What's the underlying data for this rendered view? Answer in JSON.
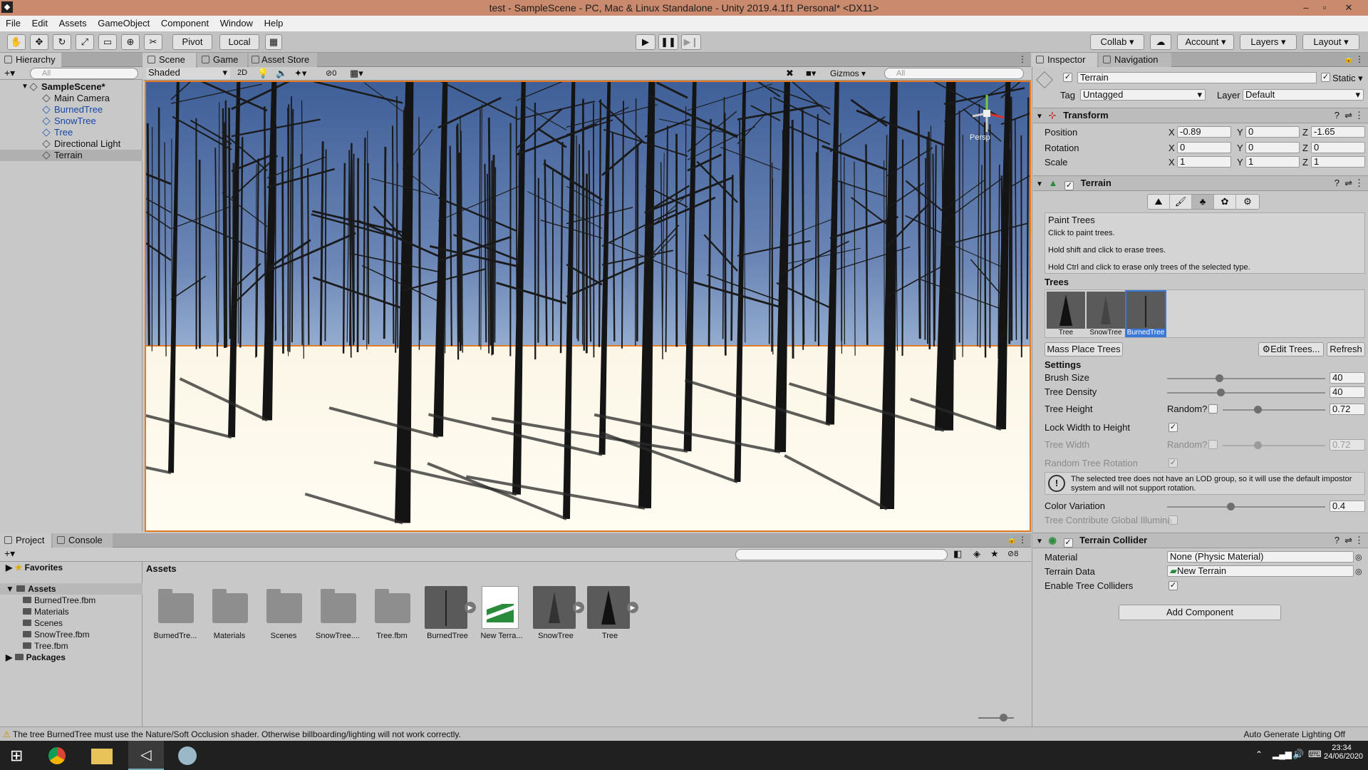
{
  "window": {
    "title": "test - SampleScene - PC, Mac & Linux Standalone - Unity 2019.4.1f1 Personal* <DX11>"
  },
  "menu": [
    "File",
    "Edit",
    "Assets",
    "GameObject",
    "Component",
    "Window",
    "Help"
  ],
  "toolbar": {
    "pivot": "Pivot",
    "local": "Local",
    "collab": "Collab",
    "account": "Account",
    "layers": "Layers",
    "layout": "Layout"
  },
  "hierarchy": {
    "tab": "Hierarchy",
    "search_placeholder": "All",
    "scene": "SampleScene*",
    "items": [
      {
        "label": "Main Camera",
        "prefab": false
      },
      {
        "label": "BurnedTree",
        "prefab": true
      },
      {
        "label": "SnowTree",
        "prefab": true
      },
      {
        "label": "Tree",
        "prefab": true
      },
      {
        "label": "Directional Light",
        "prefab": false
      },
      {
        "label": "Terrain",
        "prefab": false,
        "selected": true
      }
    ]
  },
  "scene_view": {
    "tabs": [
      "Scene",
      "Game",
      "Asset Store"
    ],
    "shading": "Shaded",
    "mode2d": "2D",
    "hidden_count": "0",
    "gizmos": "Gizmos",
    "search_placeholder": "All",
    "persp": "Persp"
  },
  "inspector": {
    "tabs": [
      "Inspector",
      "Navigation"
    ],
    "object_name": "Terrain",
    "static": "Static",
    "tag_label": "Tag",
    "tag": "Untagged",
    "layer_label": "Layer",
    "layer": "Default",
    "transform": {
      "title": "Transform",
      "position": {
        "label": "Position",
        "x": "-0.89",
        "y": "0",
        "z": "-1.65"
      },
      "rotation": {
        "label": "Rotation",
        "x": "0",
        "y": "0",
        "z": "0"
      },
      "scale": {
        "label": "Scale",
        "x": "1",
        "y": "1",
        "z": "1"
      }
    },
    "terrain": {
      "title": "Terrain",
      "help_title": "Paint Trees",
      "help_lines": [
        "Click to paint trees.",
        "Hold shift and click to erase trees.",
        "Hold Ctrl and click to erase only trees of the selected type."
      ],
      "trees_label": "Trees",
      "trees": [
        {
          "label": "Tree"
        },
        {
          "label": "SnowTree"
        },
        {
          "label": "BurnedTree",
          "selected": true
        }
      ],
      "mass_place": "Mass Place Trees",
      "edit_trees": "Edit Trees...",
      "refresh": "Refresh",
      "settings_label": "Settings",
      "brush_size": {
        "label": "Brush Size",
        "value": "40",
        "fraction": 0.33
      },
      "tree_density": {
        "label": "Tree Density",
        "value": "40",
        "fraction": 0.34
      },
      "tree_height": {
        "label": "Tree Height",
        "random": "Random?",
        "value": "0.72",
        "fraction": 0.34
      },
      "lock_width": {
        "label": "Lock Width to Height",
        "checked": true
      },
      "tree_width": {
        "label": "Tree Width",
        "random": "Random?",
        "value": "0.72",
        "fraction": 0.34
      },
      "random_rotation": {
        "label": "Random Tree Rotation"
      },
      "lod_warning": "The selected tree does not have an LOD group, so it will use the default impostor system and will not support rotation.",
      "color_variation": {
        "label": "Color Variation",
        "value": "0.4",
        "fraction": 0.4
      },
      "global_illum": "Tree Contribute Global Illumina"
    },
    "collider": {
      "title": "Terrain Collider",
      "material_label": "Material",
      "material": "None (Physic Material)",
      "data_label": "Terrain Data",
      "data": "New Terrain",
      "enable_label": "Enable Tree Colliders"
    },
    "add_component": "Add Component"
  },
  "project": {
    "tabs": [
      "Project",
      "Console"
    ],
    "tree": {
      "favorites": "Favorites",
      "assets": "Assets",
      "children": [
        "BurnedTree.fbm",
        "Materials",
        "Scenes",
        "SnowTree.fbm",
        "Tree.fbm"
      ],
      "packages": "Packages"
    },
    "breadcrumb": "Assets",
    "hidden_count": "8",
    "assets": [
      {
        "label": "BurnedTre...",
        "kind": "folder"
      },
      {
        "label": "Materials",
        "kind": "folder"
      },
      {
        "label": "Scenes",
        "kind": "folder"
      },
      {
        "label": "SnowTree....",
        "kind": "folder"
      },
      {
        "label": "Tree.fbm",
        "kind": "folder"
      },
      {
        "label": "BurnedTree",
        "kind": "model"
      },
      {
        "label": "New Terra...",
        "kind": "terrain"
      },
      {
        "label": "SnowTree",
        "kind": "model"
      },
      {
        "label": "Tree",
        "kind": "model"
      }
    ]
  },
  "status": {
    "message": "The tree BurnedTree must use the Nature/Soft Occlusion shader. Otherwise billboarding/lighting will not work correctly.",
    "lighting": "Auto Generate Lighting Off"
  },
  "taskbar": {
    "time": "23:34",
    "date": "24/06/2020"
  }
}
